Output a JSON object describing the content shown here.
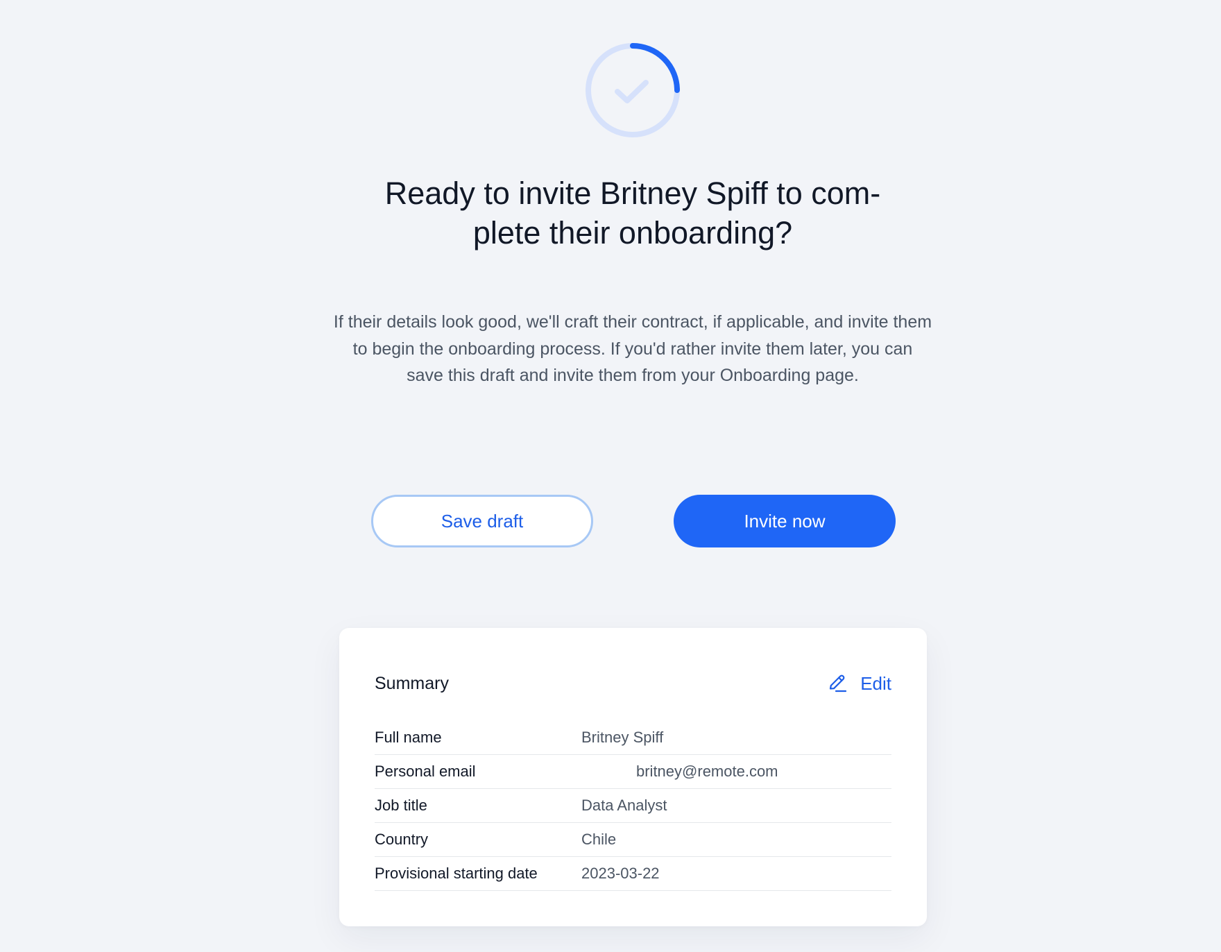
{
  "heading": "Ready to invite Britney Spiff to com-plete their onboarding?",
  "heading_lines": [
    "Ready to invite Britney Spiff to com-",
    "plete their onboarding?"
  ],
  "description": "If their details look good, we'll craft their contract, if applicable, and invite them to begin the onboarding process. If you'd rather invite them later, you can save this draft and invite them from your Onboarding page.",
  "actions": {
    "save_draft_label": "Save draft",
    "invite_now_label": "Invite now"
  },
  "progress": {
    "icon": "check-icon",
    "fraction": 0.25
  },
  "summary": {
    "title": "Summary",
    "edit_label": "Edit",
    "edit_icon": "pencil-icon",
    "rows": [
      {
        "label": "Full name",
        "value": "Britney Spiff"
      },
      {
        "label": "Personal email",
        "value": "britney@remote.com"
      },
      {
        "label": "Job title",
        "value": "Data Analyst"
      },
      {
        "label": "Country",
        "value": "Chile"
      },
      {
        "label": "Provisional starting date",
        "value": "2023-03-22"
      }
    ]
  },
  "colors": {
    "background": "#f2f4f8",
    "primary": "#1f66f6",
    "primary_text": "#1d5ee8",
    "ring_track": "#d6e1fb",
    "secondary_border": "#a7c8f5"
  }
}
